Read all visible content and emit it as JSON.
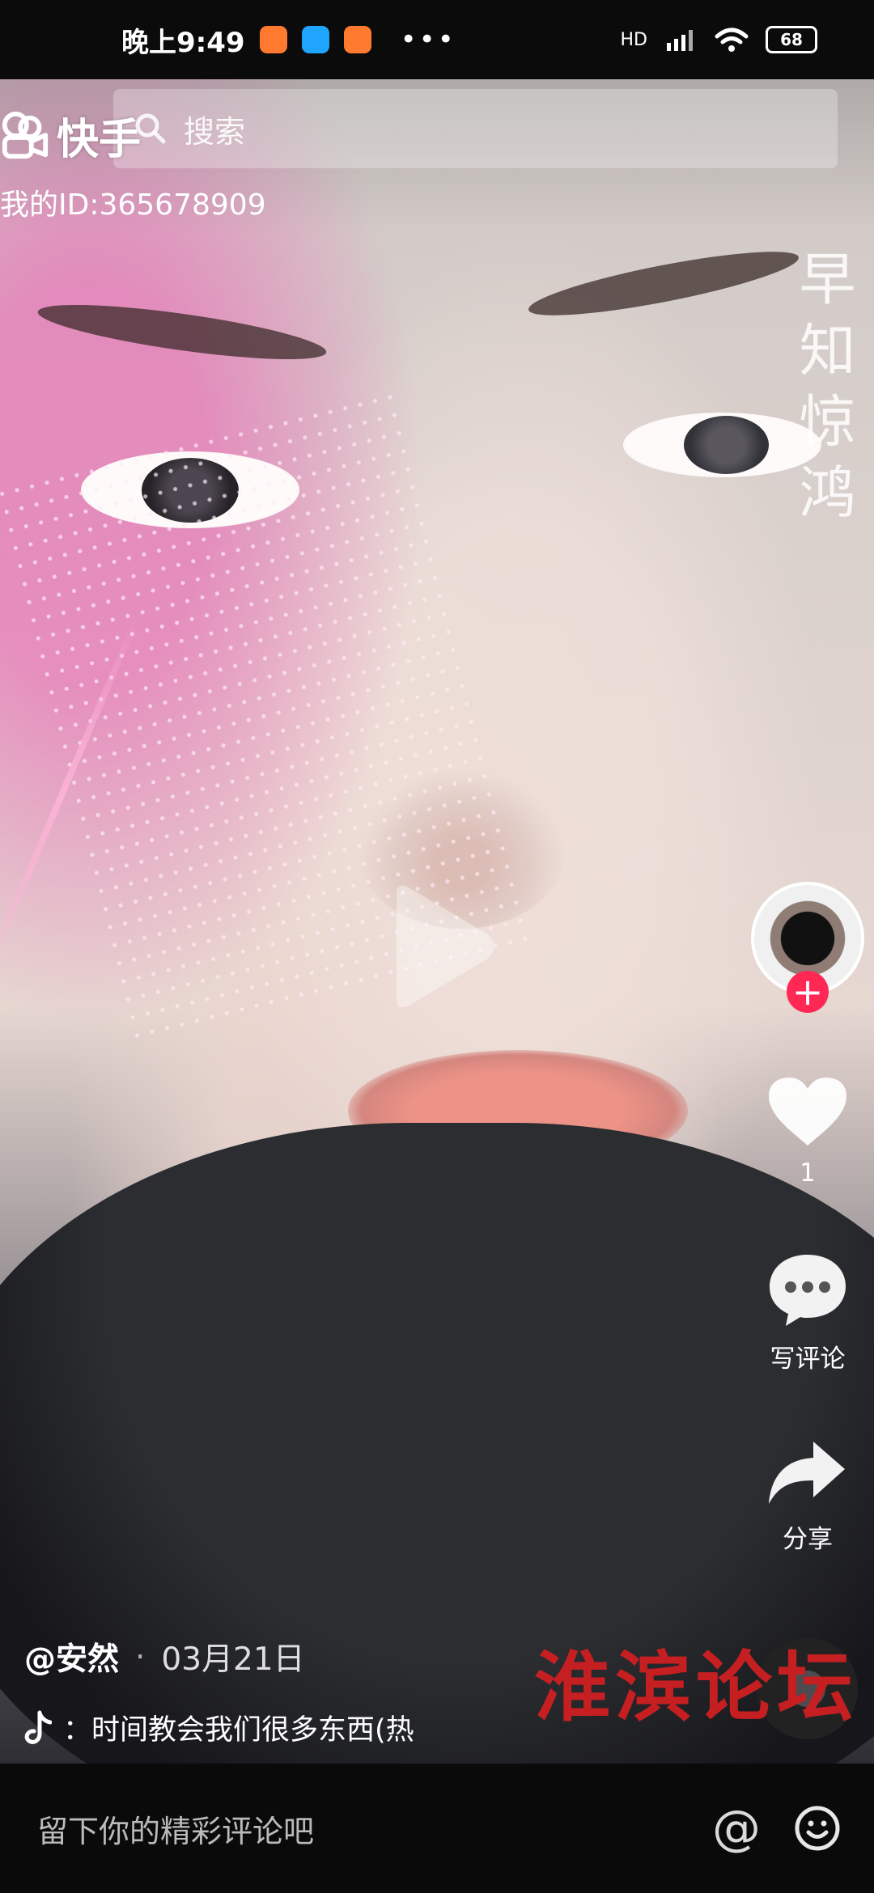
{
  "status_bar": {
    "time": "晚上9:49",
    "network": "HD",
    "battery": "68"
  },
  "search": {
    "placeholder": "搜索"
  },
  "brand": {
    "logo_text": "快手"
  },
  "profile": {
    "user_id": "我的ID:365678909"
  },
  "side_actions": {
    "like_count": "1",
    "comment_label": "写评论",
    "share_label": "分享"
  },
  "caption": {
    "author": "@安然",
    "separator": "·",
    "date": "03月21日",
    "song_text": "：时间教会我们很多东西(热"
  },
  "overlay_text": {
    "calligraphy": "早知惊鸿",
    "watermark": "淮滨论坛"
  },
  "comment_bar": {
    "placeholder": "留下你的精彩评论吧",
    "at_symbol": "@"
  },
  "icons": {
    "search": "search-icon",
    "play": "play-icon",
    "heart": "heart-icon",
    "comment": "comment-icon",
    "share": "share-icon",
    "emoji": "smile-icon"
  },
  "colors": {
    "follow": "#ff2854",
    "watermark": "#c51f22"
  }
}
